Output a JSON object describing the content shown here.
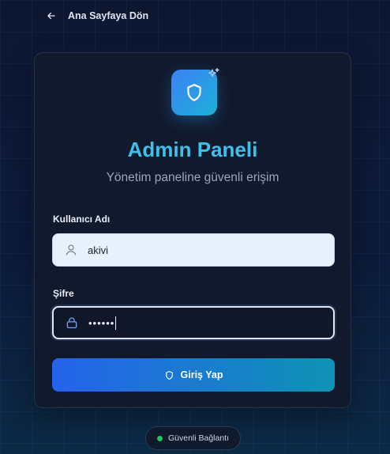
{
  "nav": {
    "back_label": "Ana Sayfaya Dön",
    "back_icon": "arrow-left-icon"
  },
  "login": {
    "logo_icon": "shield-icon",
    "sparkle_icon": "sparkles-icon",
    "title": "Admin Paneli",
    "subtitle": "Yönetim paneline güvenli erişim",
    "username": {
      "label": "Kullanıcı Adı",
      "value": "akivi",
      "icon": "user-icon"
    },
    "password": {
      "label": "Şifre",
      "value": "••••••",
      "icon": "lock-icon"
    },
    "submit": {
      "label": "Giriş Yap",
      "icon": "shield-icon"
    }
  },
  "status": {
    "label": "Güvenli Bağlantı",
    "dot_color": "#22c55e"
  },
  "colors": {
    "accent": "#3fc0ea",
    "button_start": "#2563eb",
    "button_end": "#0e93b5"
  }
}
